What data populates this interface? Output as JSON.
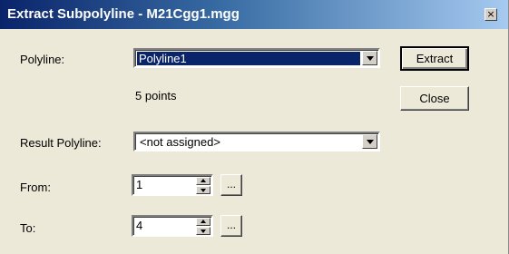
{
  "window": {
    "title": "Extract Subpolyline - M21Cgg1.mgg",
    "close_glyph": "×"
  },
  "polyline": {
    "label": "Polyline:",
    "value": "Polyline1",
    "points_text": "5 points"
  },
  "result": {
    "label": "Result Polyline:",
    "value": "<not assigned>"
  },
  "from": {
    "label": "From:",
    "value": "1",
    "browse_label": "..."
  },
  "to": {
    "label": "To:",
    "value": "4",
    "browse_label": "..."
  },
  "buttons": {
    "extract": "Extract",
    "close": "Close"
  }
}
